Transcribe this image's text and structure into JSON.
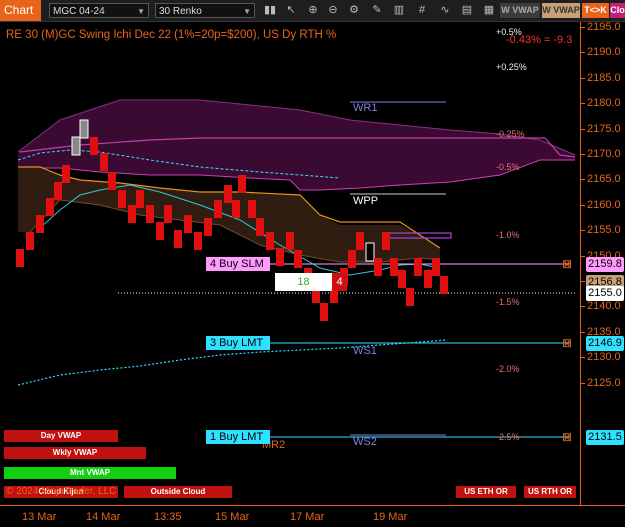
{
  "toolbar": {
    "chart_label": "Chart",
    "instrument": "MGC 04-24",
    "interval": "30 Renko",
    "pill_wvwap_1": "W VWAP",
    "pill_wvwap_2": "W VWAP",
    "pill_tk": "T<>K",
    "pill_close": "Clo"
  },
  "chart": {
    "title": "RE 30 (M)GC Swing Ichi Dec 22 (1%=20p=$200), US Dy RTH %",
    "change_pct": "-0.43% = -9.3",
    "copyright": "© 2024 NinjaTrader, LLC",
    "pct_labels": [
      "+0.5%",
      "+0.25%",
      "-0.25%",
      "-0.5%",
      "-1.0%",
      "-1.5%",
      "-2.0%",
      "-2.5%"
    ],
    "pivots": {
      "wr1": "WR1",
      "wpp": "WPP",
      "ws1": "WS1",
      "ws2": "WS2",
      "mr2": "MR2"
    },
    "orders": {
      "buy_slm": "4 Buy SLM",
      "buy_lmt_3": "3 Buy LMT",
      "buy_lmt_1": "1 Buy LMT",
      "qty": "18",
      "qty_right": "4"
    }
  },
  "price_axis": {
    "ticks": [
      "2195.0",
      "2190.0",
      "2185.0",
      "2180.0",
      "2175.0",
      "2170.0",
      "2165.0",
      "2160.0",
      "2155.0",
      "2150.0",
      "2145.0",
      "2140.0",
      "2135.0",
      "2130.0",
      "2125.0"
    ],
    "labels": {
      "slm": "2159.8",
      "p1": "2156.8",
      "last": "2155.0",
      "lmt3": "2146.9",
      "lmt1": "2131.5"
    }
  },
  "time_axis": {
    "ticks": [
      "13 Mar",
      "14 Mar",
      "13:35",
      "15 Mar",
      "17 Mar",
      "19 Mar"
    ]
  },
  "bottom_buttons": {
    "day_vwap": "Day VWAP",
    "wkly_vwap": "Wkly VWAP",
    "mnt_vwap": "Mnt VWAP",
    "cloud_kijun": "Cloud Kijun",
    "outside_cloud": "Outside Cloud",
    "us_eth": "US ETH OR",
    "us_rth": "US RTH OR"
  },
  "colors": {
    "accent": "#e8641a",
    "bear": "#e01010",
    "bull": "#ffffff",
    "buy": "#ff9bff",
    "lmt": "#30e0ff"
  }
}
